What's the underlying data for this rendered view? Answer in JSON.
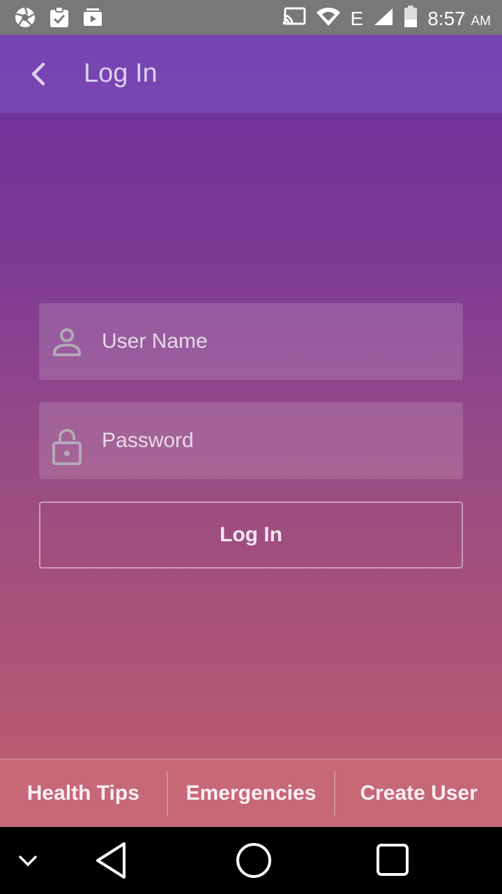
{
  "status_bar": {
    "time": "8:57",
    "ampm": "AM",
    "left_icons": [
      "aperture-icon",
      "clipboard-check-icon",
      "media-play-icon"
    ],
    "right_icons": [
      "cast-icon",
      "wifi-icon",
      "network-type-icon",
      "signal-icon",
      "battery-icon"
    ],
    "network_type": "E"
  },
  "toolbar": {
    "title": "Log In",
    "back_icon": "chevron-left-icon"
  },
  "login_form": {
    "username": {
      "placeholder": "User Name",
      "value": "",
      "icon": "user-icon"
    },
    "password": {
      "placeholder": "Password",
      "value": "",
      "icon": "lock-open-icon"
    },
    "submit_label": "Log In"
  },
  "bottom_tabs": [
    {
      "label": "Health Tips"
    },
    {
      "label": "Emergencies"
    },
    {
      "label": "Create User"
    }
  ],
  "nav_bar": {
    "icons": [
      "collapse-down-icon",
      "back-triangle-icon",
      "home-circle-icon",
      "recents-square-icon"
    ]
  },
  "colors": {
    "status_bar": "#787878",
    "gradient_top": "#6b2f9e",
    "gradient_bottom": "#bf5f6e",
    "toolbar": "#7c4eba",
    "bottom_tabs": "#c66878"
  }
}
